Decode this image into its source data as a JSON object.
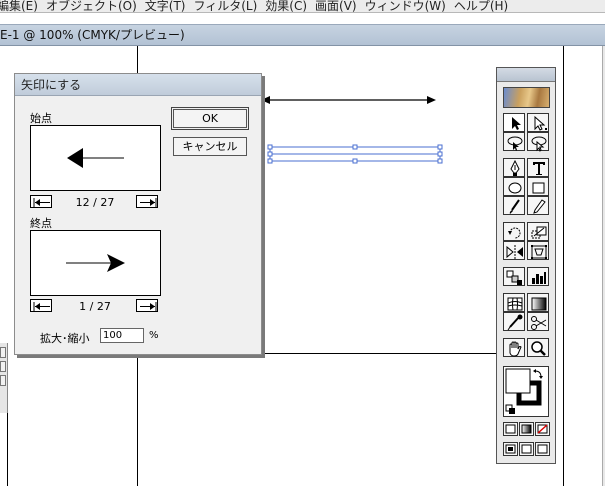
{
  "menubar": {
    "items": [
      "編集(E)",
      "オブジェクト(O)",
      "文字(T)",
      "フィルタ(L)",
      "効果(C)",
      "画面(V)",
      "ウィンドウ(W)",
      "ヘルプ(H)"
    ]
  },
  "document": {
    "title": "E-1 @ 100% (CMYK/プレビュー)"
  },
  "dialog": {
    "title": "矢印にする",
    "start": {
      "label": "始点",
      "counter": "12 / 27",
      "arrow_direction": "left"
    },
    "end": {
      "label": "終点",
      "counter": "1 / 27",
      "arrow_direction": "right"
    },
    "ok_label": "OK",
    "cancel_label": "キャンセル",
    "scale": {
      "label": "拡大･縮小",
      "value": "100",
      "unit": "%"
    }
  },
  "palette": {
    "tools": [
      {
        "name": "selection-tool-icon"
      },
      {
        "name": "direct-selection-tool-icon"
      },
      {
        "name": "lasso-tool-icon"
      },
      {
        "name": "direct-lasso-tool-icon"
      },
      {
        "name": "pen-tool-icon"
      },
      {
        "name": "type-tool-icon"
      },
      {
        "name": "ellipse-tool-icon"
      },
      {
        "name": "rectangle-tool-icon"
      },
      {
        "name": "paintbrush-tool-icon"
      },
      {
        "name": "pencil-tool-icon"
      },
      {
        "name": "rotate-tool-icon"
      },
      {
        "name": "scale-tool-icon"
      },
      {
        "name": "reflect-tool-icon"
      },
      {
        "name": "free-transform-tool-icon"
      },
      {
        "name": "blend-tool-icon"
      },
      {
        "name": "graph-tool-icon"
      },
      {
        "name": "mesh-tool-icon"
      },
      {
        "name": "gradient-tool-icon"
      },
      {
        "name": "eyedropper-tool-icon"
      },
      {
        "name": "scissors-tool-icon"
      },
      {
        "name": "hand-tool-icon"
      },
      {
        "name": "zoom-tool-icon"
      }
    ],
    "colors": {
      "fill": "#ffffff",
      "stroke": "#000000"
    }
  }
}
